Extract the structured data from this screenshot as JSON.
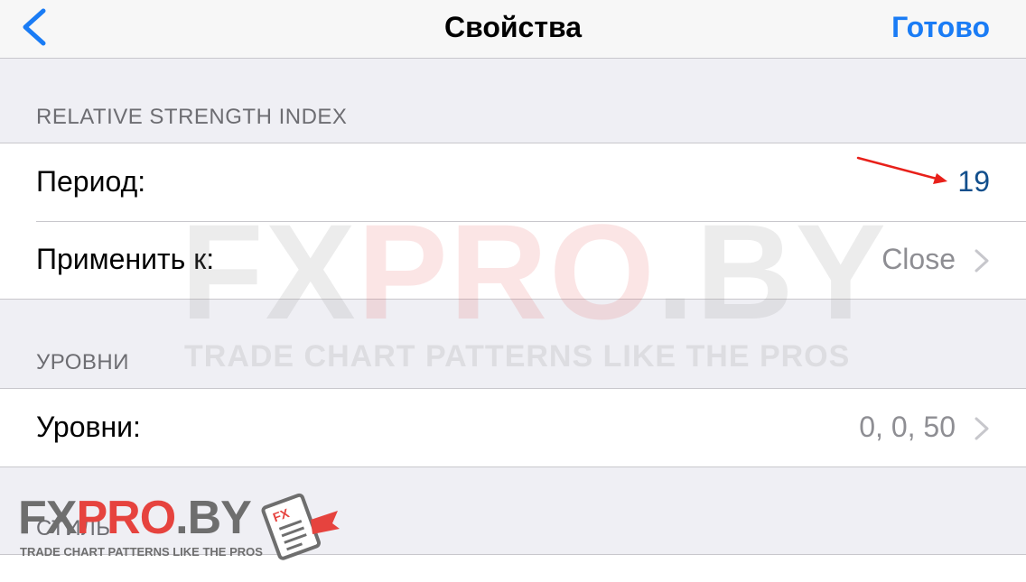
{
  "navbar": {
    "title": "Свойства",
    "done_label": "Готово",
    "back_icon": "chevron-left-icon"
  },
  "sections": [
    {
      "header": "RELATIVE STRENGTH INDEX",
      "rows": [
        {
          "label": "Период:",
          "value": "19"
        },
        {
          "label": "Применить к:",
          "value": "Close"
        }
      ]
    },
    {
      "header": "УРОВНИ",
      "rows": [
        {
          "label": "Уровни:",
          "value": "0, 0, 50"
        }
      ]
    },
    {
      "header": "СТИЛЬ"
    }
  ],
  "watermark": {
    "brand_a": "FX",
    "brand_b": "PRO",
    "brand_c": ".BY",
    "tagline": "TRADE CHART PATTERNS LIKE THE PROS"
  },
  "logo": {
    "brand_a": "FX",
    "brand_b": "PRO",
    "brand_c": ".BY",
    "tagline": "TRADE CHART PATTERNS LIKE THE PROS",
    "icon_label": "FX"
  },
  "colors": {
    "accent": "#1a7cf5",
    "value_blue": "#124f8c",
    "arrow": "#e8201a",
    "logo_red": "#e6433e"
  }
}
